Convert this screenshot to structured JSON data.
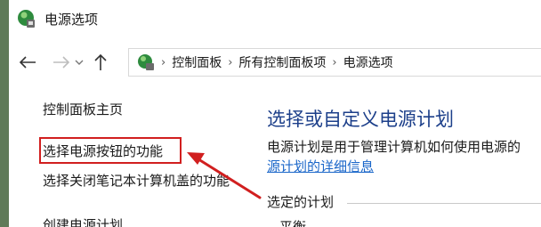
{
  "window": {
    "title": "电源选项"
  },
  "nav": {
    "back_icon": "arrow-left-icon",
    "forward_icon": "arrow-right-icon",
    "recent_icon": "chevron-down-icon",
    "up_icon": "arrow-up-icon"
  },
  "address": {
    "crumbs": [
      "控制面板",
      "所有控制面板项",
      "电源选项"
    ]
  },
  "sidebar": {
    "items": [
      {
        "label": "控制面板主页"
      },
      {
        "label": "选择电源按钮的功能"
      },
      {
        "label": "选择关闭笔记本计算机盖的功能"
      },
      {
        "label": "创建电源计划"
      }
    ]
  },
  "main": {
    "title": "选择或自定义电源计划",
    "description": "电源计划是用于管理计算机如何使用电源的",
    "more_link": "源计划的详细信息",
    "section_label": "选定的计划",
    "partial_text": "平衡"
  },
  "colors": {
    "highlight": "#d11f1f",
    "title_blue": "#1c3f8a",
    "link_blue": "#1a66c9"
  }
}
